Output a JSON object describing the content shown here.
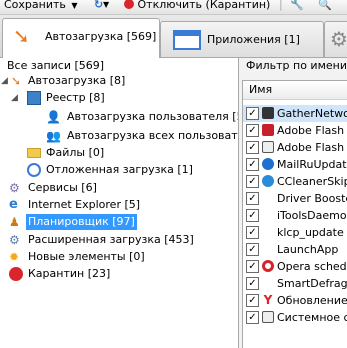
{
  "toolbar": {
    "save": "Сохранить",
    "disable": "Отключить (Карантин)"
  },
  "tabs": [
    {
      "label": "Автозагрузка [569]"
    },
    {
      "label": "Приложения [1]"
    }
  ],
  "tree": [
    {
      "label": "Все записи [569]"
    },
    {
      "label": "Автозагрузка [8]"
    },
    {
      "label": "Реестр [8]"
    },
    {
      "label": "Автозагрузка пользователя [5"
    },
    {
      "label": "Автозагрузка всех пользовате"
    },
    {
      "label": "Файлы [0]"
    },
    {
      "label": "Отложенная загрузка [1]"
    },
    {
      "label": "Сервисы [6]"
    },
    {
      "label": "Internet Explorer [5]"
    },
    {
      "label": "Планировщик [97]"
    },
    {
      "label": "Расширенная загрузка [453]"
    },
    {
      "label": "Новые элементы [0]"
    },
    {
      "label": "Карантин [23]"
    }
  ],
  "filter": {
    "label": "Фильтр по имени:"
  },
  "grid": {
    "header": "Имя",
    "rows": [
      {
        "name": "GatherNetwo"
      },
      {
        "name": "Adobe Flash"
      },
      {
        "name": "Adobe Flash"
      },
      {
        "name": "MailRuUpdat"
      },
      {
        "name": "CCleanerSkip"
      },
      {
        "name": "Driver Booste"
      },
      {
        "name": "iToolsDaemo"
      },
      {
        "name": "klcp_update"
      },
      {
        "name": "LaunchApp"
      },
      {
        "name": "Opera sched"
      },
      {
        "name": "SmartDefrag_"
      },
      {
        "name": "Обновление"
      },
      {
        "name": "Системное с"
      }
    ]
  }
}
